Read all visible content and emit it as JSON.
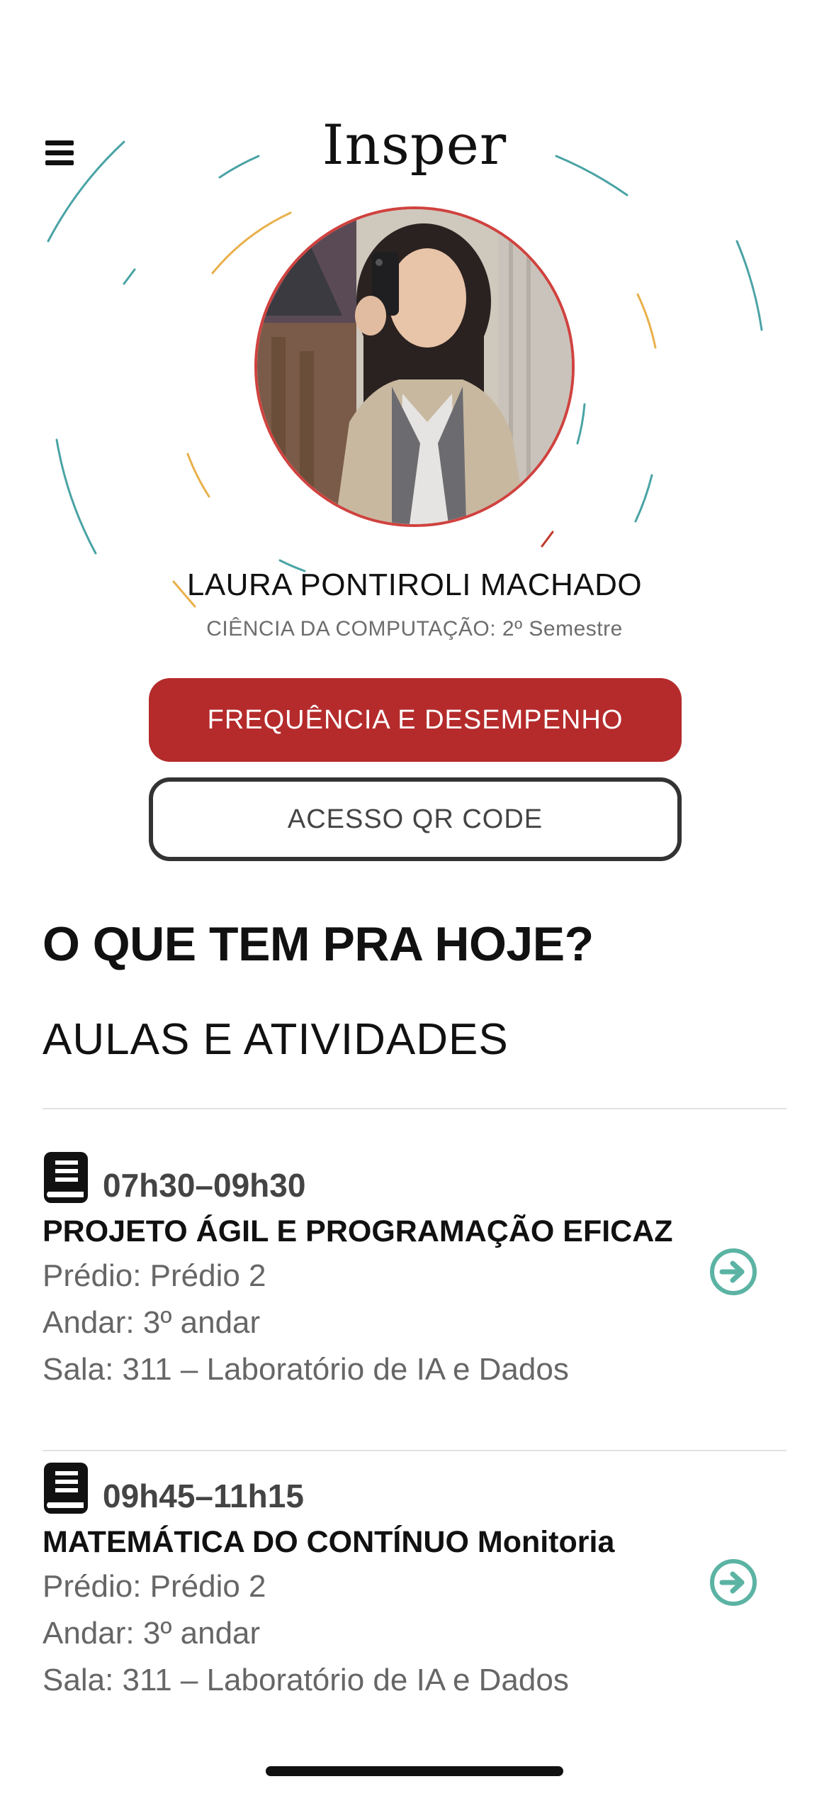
{
  "header": {
    "menu_icon": "hamburger-menu-icon",
    "logo_text": "Insper"
  },
  "profile": {
    "name": "LAURA PONTIROLI MACHADO",
    "course": "CIÊNCIA DA COMPUTAÇÃO: 2º Semestre",
    "avatar_icon": "student-photo"
  },
  "actions": {
    "primary_label": "FREQUÊNCIA E DESEMPENHO",
    "secondary_label": "ACESSO QR CODE"
  },
  "colors": {
    "accent_red": "#b52b2c",
    "accent_teal": "#5bb3a3",
    "ring_orange": "#e9b04a",
    "ring_teal": "#4aa3a5"
  },
  "today": {
    "title": "O QUE TEM PRA HOJE?",
    "subtitle": "AULAS E ATIVIDADES",
    "classes": [
      {
        "icon": "book-icon",
        "time": "07h30–09h30",
        "title": "PROJETO ÁGIL E PROGRAMAÇÃO EFICAZ",
        "building": "Prédio: Prédio 2",
        "floor": "Andar: 3º andar",
        "room": "Sala: 311 – Laboratório de IA e Dados",
        "arrow_icon": "arrow-right-circle-icon"
      },
      {
        "icon": "book-icon",
        "time": "09h45–11h15",
        "title": "MATEMÁTICA DO CONTÍNUO Monitoria",
        "building": "Prédio: Prédio 2",
        "floor": "Andar: 3º andar",
        "room": "Sala: 311 – Laboratório de IA e Dados",
        "arrow_icon": "arrow-right-circle-icon"
      }
    ]
  }
}
